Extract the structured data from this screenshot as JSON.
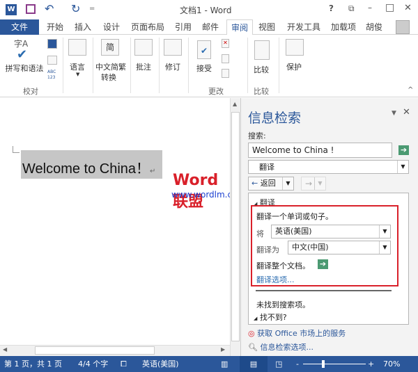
{
  "title_bar": {
    "title": "文档1 - Word",
    "help": "?",
    "restore_ribbon": "⧉",
    "minimize": "–",
    "maximize": "□",
    "close": "✕",
    "undo": "↶",
    "redo": "↻",
    "qat_more": "="
  },
  "tabs": [
    {
      "label": "文件"
    },
    {
      "label": "开始"
    },
    {
      "label": "插入"
    },
    {
      "label": "设计"
    },
    {
      "label": "页面布局"
    },
    {
      "label": "引用"
    },
    {
      "label": "邮件"
    },
    {
      "label": "审阅",
      "active": true
    },
    {
      "label": "视图"
    },
    {
      "label": "开发工具"
    },
    {
      "label": "加载项"
    },
    {
      "label": "胡俊"
    }
  ],
  "ribbon": {
    "spelling": "拼写和语法",
    "language": "语言",
    "chinese_convert_1": "中文简繁",
    "chinese_convert_2": "转换",
    "comment": "批注",
    "track": "修订",
    "accept": "接受",
    "compare": "比较",
    "protect": "保护",
    "groups": {
      "proofing": "校对",
      "changes": "更改",
      "compare": "比较"
    },
    "spell_glyph": "字A",
    "abc": "ABC 123",
    "jian": "简"
  },
  "document": {
    "text": "Welcome to China！",
    "para_mark": "↵"
  },
  "watermark": {
    "brand": "Word联盟",
    "url": "www.wordlm.com"
  },
  "pane": {
    "title": "信息检索",
    "search_label": "搜索:",
    "search_value": "Welcome to China !",
    "service": "翻译",
    "back": "返回",
    "section": "翻译",
    "intro": "翻译一个单词或句子。",
    "from_label": "将",
    "from_value": "英语(美国)",
    "to_label": "翻译为",
    "to_value": "中文(中国)",
    "whole_doc": "翻译整个文档。",
    "options_link": "翻译选项...",
    "not_found": "未找到搜索项。",
    "cant_find": "找不到?",
    "market": "获取 Office 市场上的服务",
    "research_options": "信息检索选项...",
    "highlight_color": "#d9202a"
  },
  "status": {
    "page": "第 1 页，共 1 页",
    "words": "4/4 个字",
    "language": "英语(美国)",
    "zoom": "70%",
    "zoom_value": 70,
    "color": "#2b579a"
  }
}
